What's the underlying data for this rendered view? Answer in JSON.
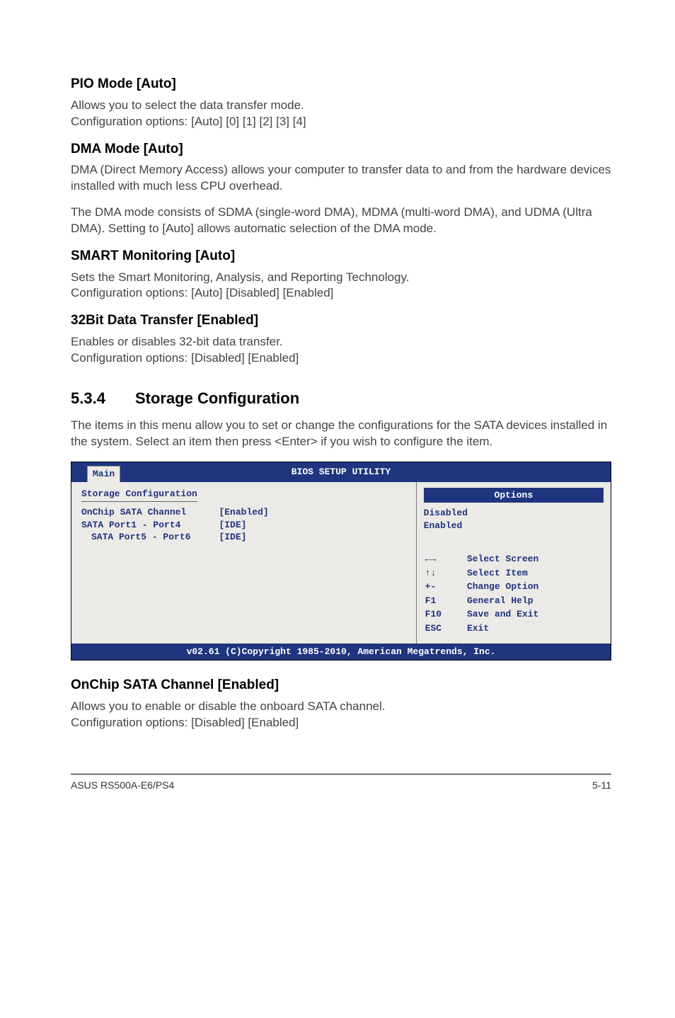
{
  "sections": {
    "pio": {
      "heading": "PIO Mode [Auto]",
      "p1": "Allows you to select the data transfer mode.",
      "p2": "Configuration options: [Auto] [0] [1] [2] [3] [4]"
    },
    "dma": {
      "heading": "DMA Mode [Auto]",
      "p1": "DMA (Direct Memory Access) allows your computer to transfer data to and from the hardware devices installed with much less CPU overhead.",
      "p2": "The DMA mode consists of SDMA (single-word DMA), MDMA (multi-word DMA), and UDMA (Ultra DMA). Setting to [Auto] allows automatic selection of the DMA mode."
    },
    "smart": {
      "heading": "SMART Monitoring [Auto]",
      "p1": "Sets the Smart Monitoring, Analysis, and Reporting Technology.",
      "p2": "Configuration options: [Auto] [Disabled] [Enabled]"
    },
    "bit32": {
      "heading": "32Bit Data Transfer [Enabled]",
      "p1": "Enables or disables 32-bit data transfer.",
      "p2": "Configuration options: [Disabled] [Enabled]"
    },
    "storage": {
      "num": "5.3.4",
      "title": "Storage Configuration",
      "intro": "The items in this menu allow you to set or change the configurations for the SATA devices installed in the system. Select an item then press <Enter> if you wish to configure the item."
    },
    "onchip": {
      "heading": "OnChip SATA Channel [Enabled]",
      "p1": "Allows you to enable or disable the onboard SATA channel.",
      "p2": "Configuration options: [Disabled] [Enabled]"
    }
  },
  "bios": {
    "title": "BIOS SETUP UTILITY",
    "tab": "Main",
    "left_header": "Storage Configuration",
    "rows": [
      {
        "label": "OnChip SATA Channel",
        "value": "[Enabled]",
        "indent": false
      },
      {
        "label": "SATA Port1 - Port4",
        "value": "[IDE]",
        "indent": false
      },
      {
        "label": "SATA Port5 - Port6",
        "value": "[IDE]",
        "indent": true
      }
    ],
    "options_title": "Options",
    "options": [
      "Disabled",
      "Enabled"
    ],
    "keys": [
      {
        "k": "←→",
        "d": "Select Screen"
      },
      {
        "k": "↑↓",
        "d": "Select Item"
      },
      {
        "k": "+-",
        "d": "Change Option"
      },
      {
        "k": "F1",
        "d": "General Help"
      },
      {
        "k": "F10",
        "d": "Save and Exit"
      },
      {
        "k": "ESC",
        "d": "Exit"
      }
    ],
    "footer": "v02.61 (C)Copyright 1985-2010, American Megatrends, Inc."
  },
  "footer": {
    "left": "ASUS RS500A-E6/PS4",
    "right": "5-11"
  }
}
